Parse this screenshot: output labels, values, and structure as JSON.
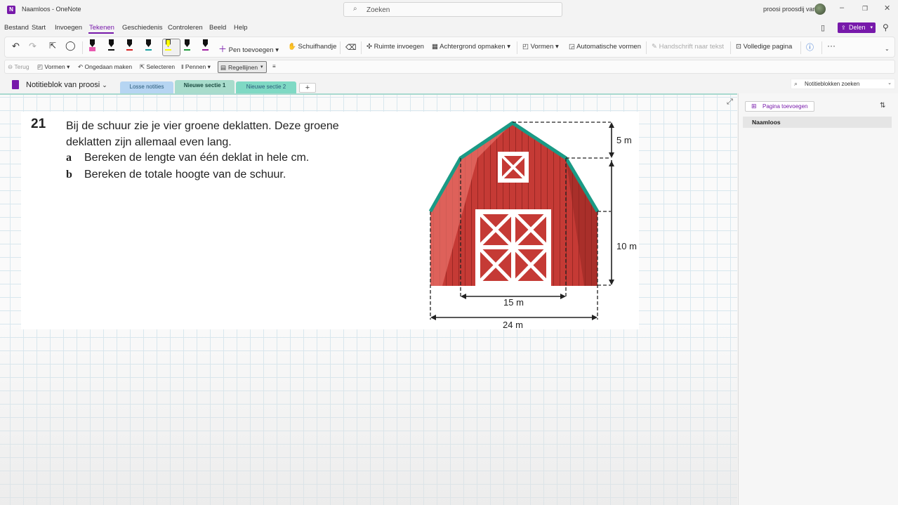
{
  "window": {
    "app_icon_letter": "N",
    "title": "Naamloos - OneNote",
    "search_placeholder": "Zoeken",
    "user_name": "proosi proosdij van",
    "minimize": "–",
    "restore": "❐",
    "close": "✕"
  },
  "menu": {
    "items": [
      "Bestand",
      "Start",
      "Invoegen",
      "Tekenen",
      "Geschiedenis",
      "Controleren",
      "Beeld",
      "Help"
    ],
    "active": "Tekenen",
    "share_label": "Delen"
  },
  "ribbon": {
    "pens": [
      {
        "name": "pen-pink",
        "color": "#e85ab0"
      },
      {
        "name": "pen-black",
        "color": "#111111"
      },
      {
        "name": "pen-red",
        "color": "#d42020"
      },
      {
        "name": "pen-teal",
        "color": "#1a9ea0"
      },
      {
        "name": "pen-yellow-highlighter",
        "color": "#ffff00"
      },
      {
        "name": "pen-green",
        "color": "#1f9a3c"
      },
      {
        "name": "pen-purple",
        "color": "#a020a0"
      }
    ],
    "add_pen": "Pen toevoegen",
    "lasso": "Schuifhandje",
    "insert_space": "Ruimte invoegen",
    "background": "Achtergrond opmaken",
    "shapes": "Vormen",
    "auto_shapes": "Automatische vormen",
    "ink_to_text": "Handschrift naar tekst",
    "full_page": "Volledige pagina",
    "more": "···"
  },
  "toolbar2": {
    "back": "Terug",
    "shapes": "Vormen",
    "undo": "Ongedaan maken",
    "select": "Selecteren",
    "pens": "Pennen",
    "rule_lines": "Regellijnen"
  },
  "notebook": {
    "name": "Notitieblok van proosi",
    "sections": [
      {
        "label": "Losse notities",
        "color": "#b6d5f2"
      },
      {
        "label": "Nieuwe sectie 1",
        "color": "#a8dccc"
      },
      {
        "label": "Nieuwe sectie 2",
        "color": "#7fd9c4"
      }
    ],
    "search_placeholder": "Notitieblokken zoeken"
  },
  "content": {
    "question_number": "21",
    "question_text": "Bij de schuur zie je vier groene deklatten. Deze groene deklatten zijn allemaal even lang.",
    "sub_a_label": "a",
    "sub_a_text": "Bereken de lengte van één deklat in hele cm.",
    "sub_b_label": "b",
    "sub_b_text": "Bereken de totale hoogte van de schuur.",
    "dim_top": "5 m",
    "dim_side": "10 m",
    "dim_inner": "15 m",
    "dim_outer": "24 m"
  },
  "sidebar": {
    "add_page": "Pagina toevoegen",
    "pages": [
      "Naamloos"
    ]
  }
}
